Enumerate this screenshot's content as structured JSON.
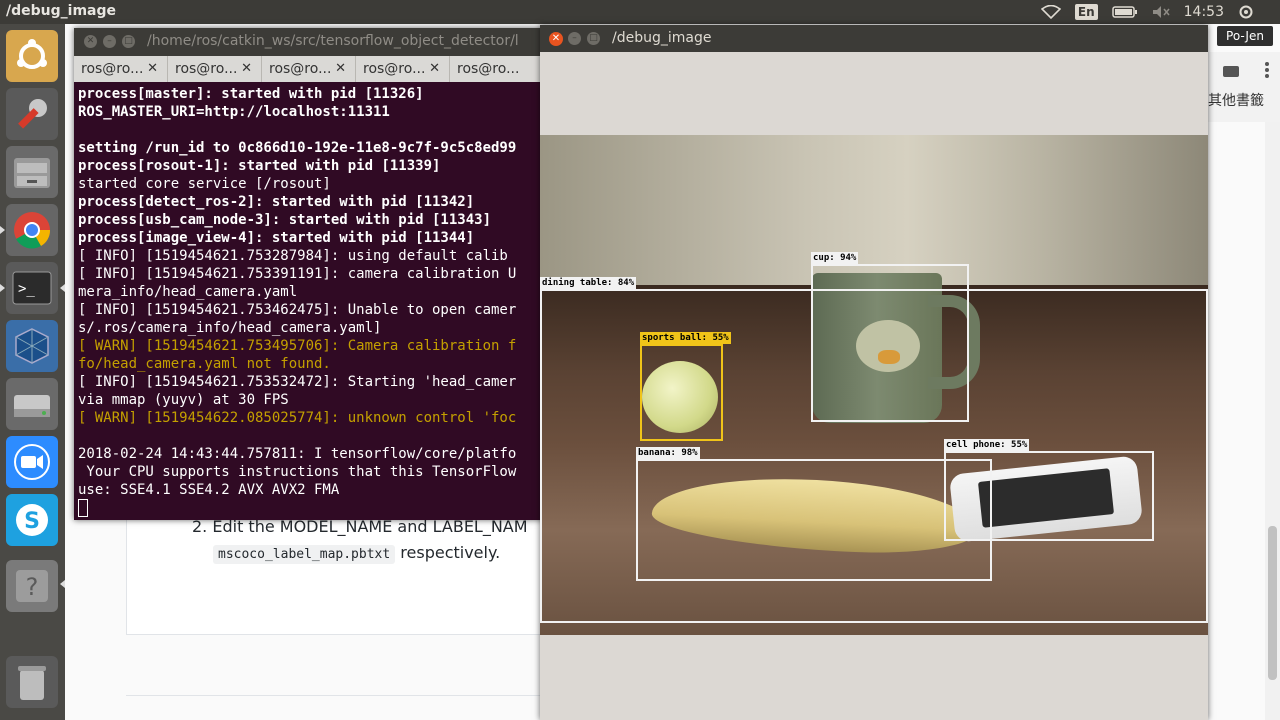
{
  "topbar": {
    "title": "/debug_image",
    "lang": "En",
    "clock": "14:53"
  },
  "browser": {
    "user_button": "Po-Jen",
    "bookmarks_label": "其他書籤",
    "doc_item_text": "2. Edit the MODEL_NAME and LABEL_NAM",
    "doc_code": "mscoco_label_map.pbtxt",
    "doc_item_tail": "respectively."
  },
  "terminal": {
    "title": "/home/ros/catkin_ws/src/tensorflow_object_detector/l",
    "tabs": [
      "ros@ro...",
      "ros@ro...",
      "ros@ro...",
      "ros@ro...",
      "ros@ro..."
    ],
    "lines": [
      {
        "text": "process[master]: started with pid [11326]",
        "style": "b"
      },
      {
        "text": "ROS_MASTER_URI=http://localhost:11311",
        "style": "b"
      },
      {
        "text": "",
        "style": ""
      },
      {
        "text": "setting /run_id to 0c866d10-192e-11e8-9c7f-9c5c8ed99",
        "style": "b"
      },
      {
        "text": "process[rosout-1]: started with pid [11339]",
        "style": "b"
      },
      {
        "text": "started core service [/rosout]",
        "style": ""
      },
      {
        "text": "process[detect_ros-2]: started with pid [11342]",
        "style": "b"
      },
      {
        "text": "process[usb_cam_node-3]: started with pid [11343]",
        "style": "b"
      },
      {
        "text": "process[image_view-4]: started with pid [11344]",
        "style": "b"
      },
      {
        "text": "[ INFO] [1519454621.753287984]: using default calib",
        "style": ""
      },
      {
        "text": "[ INFO] [1519454621.753391191]: camera calibration U",
        "style": ""
      },
      {
        "text": "mera_info/head_camera.yaml",
        "style": ""
      },
      {
        "text": "[ INFO] [1519454621.753462475]: Unable to open camer",
        "style": ""
      },
      {
        "text": "s/.ros/camera_info/head_camera.yaml]",
        "style": ""
      },
      {
        "text": "[ WARN] [1519454621.753495706]: Camera calibration f",
        "style": "w"
      },
      {
        "text": "fo/head_camera.yaml not found.",
        "style": "w"
      },
      {
        "text": "[ INFO] [1519454621.753532472]: Starting 'head_camer",
        "style": ""
      },
      {
        "text": "via mmap (yuyv) at 30 FPS",
        "style": ""
      },
      {
        "text": "[ WARN] [1519454622.085025774]: unknown control 'foc",
        "style": "w"
      },
      {
        "text": "",
        "style": ""
      },
      {
        "text": "2018-02-24 14:43:44.757811: I tensorflow/core/platfo",
        "style": ""
      },
      {
        "text": " Your CPU supports instructions that this TensorFlow",
        "style": ""
      },
      {
        "text": "use: SSE4.1 SSE4.2 AVX AVX2 FMA",
        "style": ""
      }
    ]
  },
  "debug_window": {
    "title": "/debug_image",
    "detections": [
      {
        "label": "dining table: 84%",
        "color": "#f2f2f2"
      },
      {
        "label": "cup: 94%",
        "color": "#f2f2f2"
      },
      {
        "label": "sports ball: 55%",
        "color": "#f0c419"
      },
      {
        "label": "banana: 98%",
        "color": "#f2f2f2"
      },
      {
        "label": "cell phone: 55%",
        "color": "#f2f2f2"
      }
    ]
  },
  "launcher": {
    "icons": [
      "ubuntu-logo-icon",
      "system-settings-icon",
      "file-manager-icon",
      "chrome-icon",
      "terminal-icon",
      "virtualbox-icon",
      "disk-icon",
      "zoom-icon",
      "skype-icon",
      "help-icon",
      "trash-icon"
    ]
  }
}
